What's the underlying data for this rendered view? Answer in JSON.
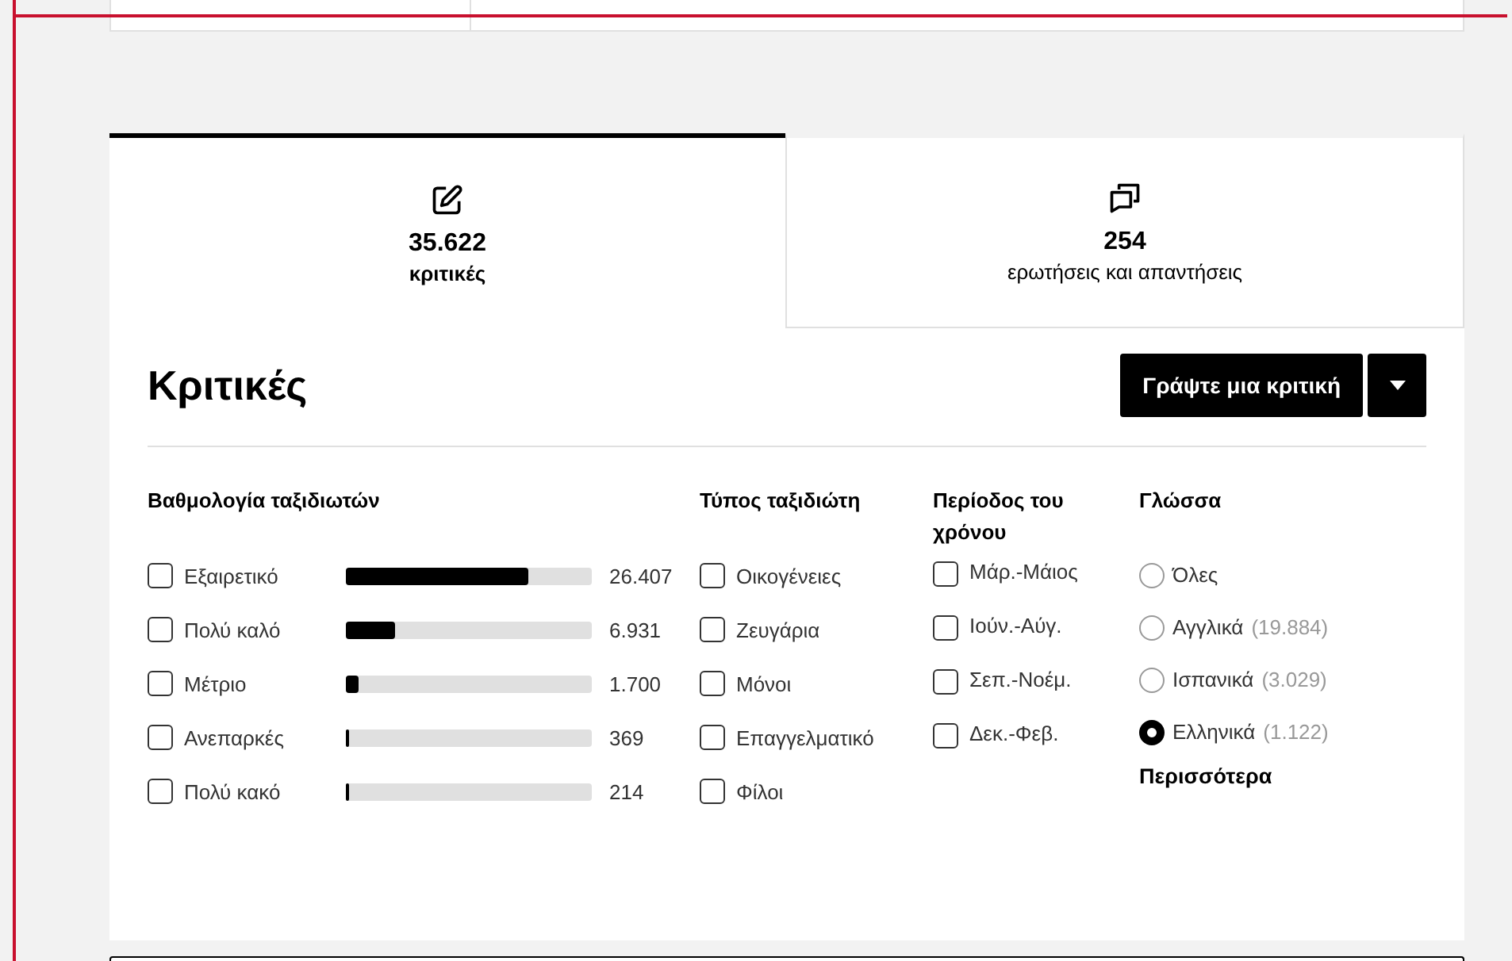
{
  "tabs": [
    {
      "count": "35.622",
      "label": "κριτικές",
      "selected": true
    },
    {
      "count": "254",
      "label": "ερωτήσεις και απαντήσεις",
      "selected": false
    }
  ],
  "heading": "Κριτικές",
  "write_button": "Γράψτε μια κριτική",
  "rating": {
    "title": "Βαθμολογία ταξιδιωτών",
    "rows": [
      {
        "label": "Εξαιρετικό",
        "checked": false,
        "level": 0.74,
        "count": "26.407"
      },
      {
        "label": "Πολύ καλό",
        "checked": false,
        "level": 0.2,
        "count": "6.931"
      },
      {
        "label": "Μέτριο",
        "checked": false,
        "level": 0.05,
        "count": "1.700"
      },
      {
        "label": "Ανεπαρκές",
        "checked": false,
        "level": 0.01,
        "count": "369"
      },
      {
        "label": "Πολύ κακό",
        "checked": false,
        "level": 0.01,
        "count": "214"
      }
    ]
  },
  "traveler_type": {
    "title": "Τύπος ταξιδιώτη",
    "options": [
      {
        "label": "Οικογένειες",
        "checked": false
      },
      {
        "label": "Ζευγάρια",
        "checked": false
      },
      {
        "label": "Μόνοι",
        "checked": false
      },
      {
        "label": "Επαγγελματικό",
        "checked": false
      },
      {
        "label": "Φίλοι",
        "checked": false
      }
    ]
  },
  "period": {
    "title": "Περίοδος του χρόνου",
    "options": [
      {
        "label": "Μάρ.-Μάιος",
        "checked": false
      },
      {
        "label": "Ιούν.-Αύγ.",
        "checked": false
      },
      {
        "label": "Σεπ.-Νοέμ.",
        "checked": false
      },
      {
        "label": "Δεκ.-Φεβ.",
        "checked": false
      }
    ]
  },
  "language": {
    "title": "Γλώσσα",
    "options": [
      {
        "label": "Όλες",
        "selected": false
      },
      {
        "label": "Αγγλικά",
        "count": "(19.884)",
        "selected": false
      },
      {
        "label": "Ισπανικά",
        "count": "(3.029)",
        "selected": false
      },
      {
        "label": "Ελληνικά",
        "count": "(1.122)",
        "selected": true
      }
    ],
    "more": "Περισσότερα"
  }
}
